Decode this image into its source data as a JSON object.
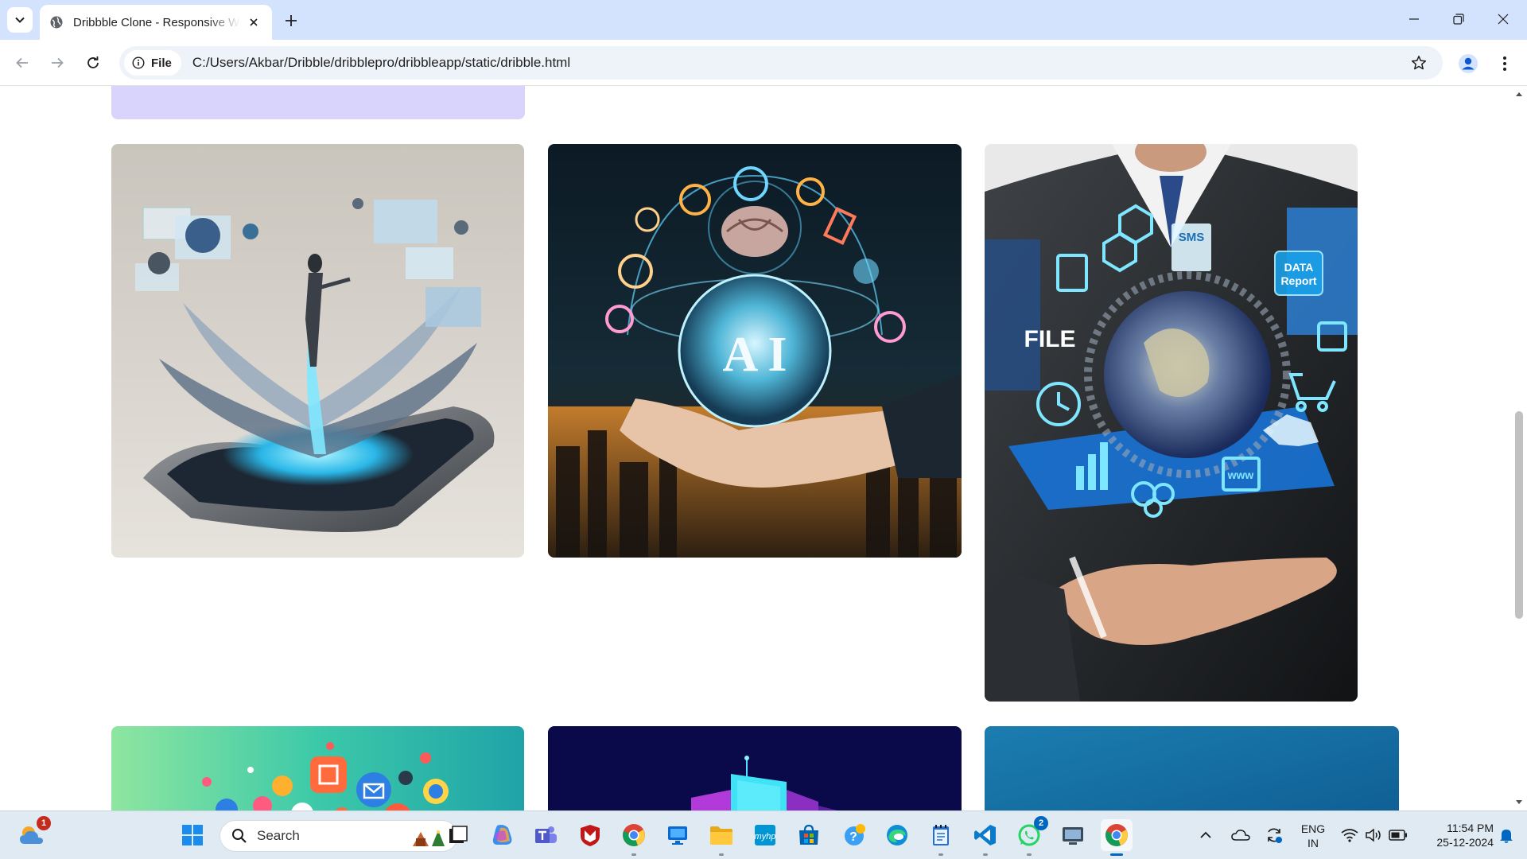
{
  "browser": {
    "tab_title": "Dribbble Clone - Responsive Web",
    "security_chip_label": "File",
    "url": "C:/Users/Akbar/Dribble/dribblepro/dribbleapp/static/dribble.html"
  },
  "page": {
    "shots": [
      {
        "name": "shot-lilac-partial",
        "subject": "lilac color panel (cut off at top)"
      },
      {
        "name": "shot-ai-phone-hologram",
        "subject": "holographic figure emerging from a smartphone"
      },
      {
        "name": "shot-ai-globe-hand",
        "subject": "hand holding a glowing AI globe above a night city",
        "printed_text": "AI"
      },
      {
        "name": "shot-businessman-globe",
        "subject": "businessman holding a globe surrounded by tech icons",
        "printed_text": [
          "SMS",
          "DATA Report",
          "FILE",
          "www"
        ]
      },
      {
        "name": "shot-social-icons",
        "subject": "colorful social media icons on teal gradient (cut off at bottom)"
      },
      {
        "name": "shot-navy-bars",
        "subject": "neon 3D bars on navy background (cut off at bottom)"
      },
      {
        "name": "shot-blue-gradient",
        "subject": "blue gradient panel (cut off at bottom)"
      }
    ]
  },
  "taskbar": {
    "search_placeholder": "Search",
    "weather_badge": "1",
    "whatsapp_badge": "2",
    "language_line1": "ENG",
    "language_line2": "IN",
    "time": "11:54 PM",
    "date": "25-12-2024",
    "apps": [
      "start",
      "search",
      "file-explorer-widget",
      "task-view",
      "copilot",
      "teams",
      "mcafee",
      "chrome",
      "remote-desktop",
      "file-explorer",
      "myhp",
      "microsoft-store",
      "help",
      "edge",
      "notepad",
      "vscode",
      "whatsapp",
      "screen-tool",
      "chrome-active"
    ]
  },
  "colors": {
    "tabstrip_bg": "#d3e3fd",
    "omnibox_bg": "#eef2f9",
    "taskbar_bg": "#dfeaf3",
    "accent": "#0067c0"
  }
}
